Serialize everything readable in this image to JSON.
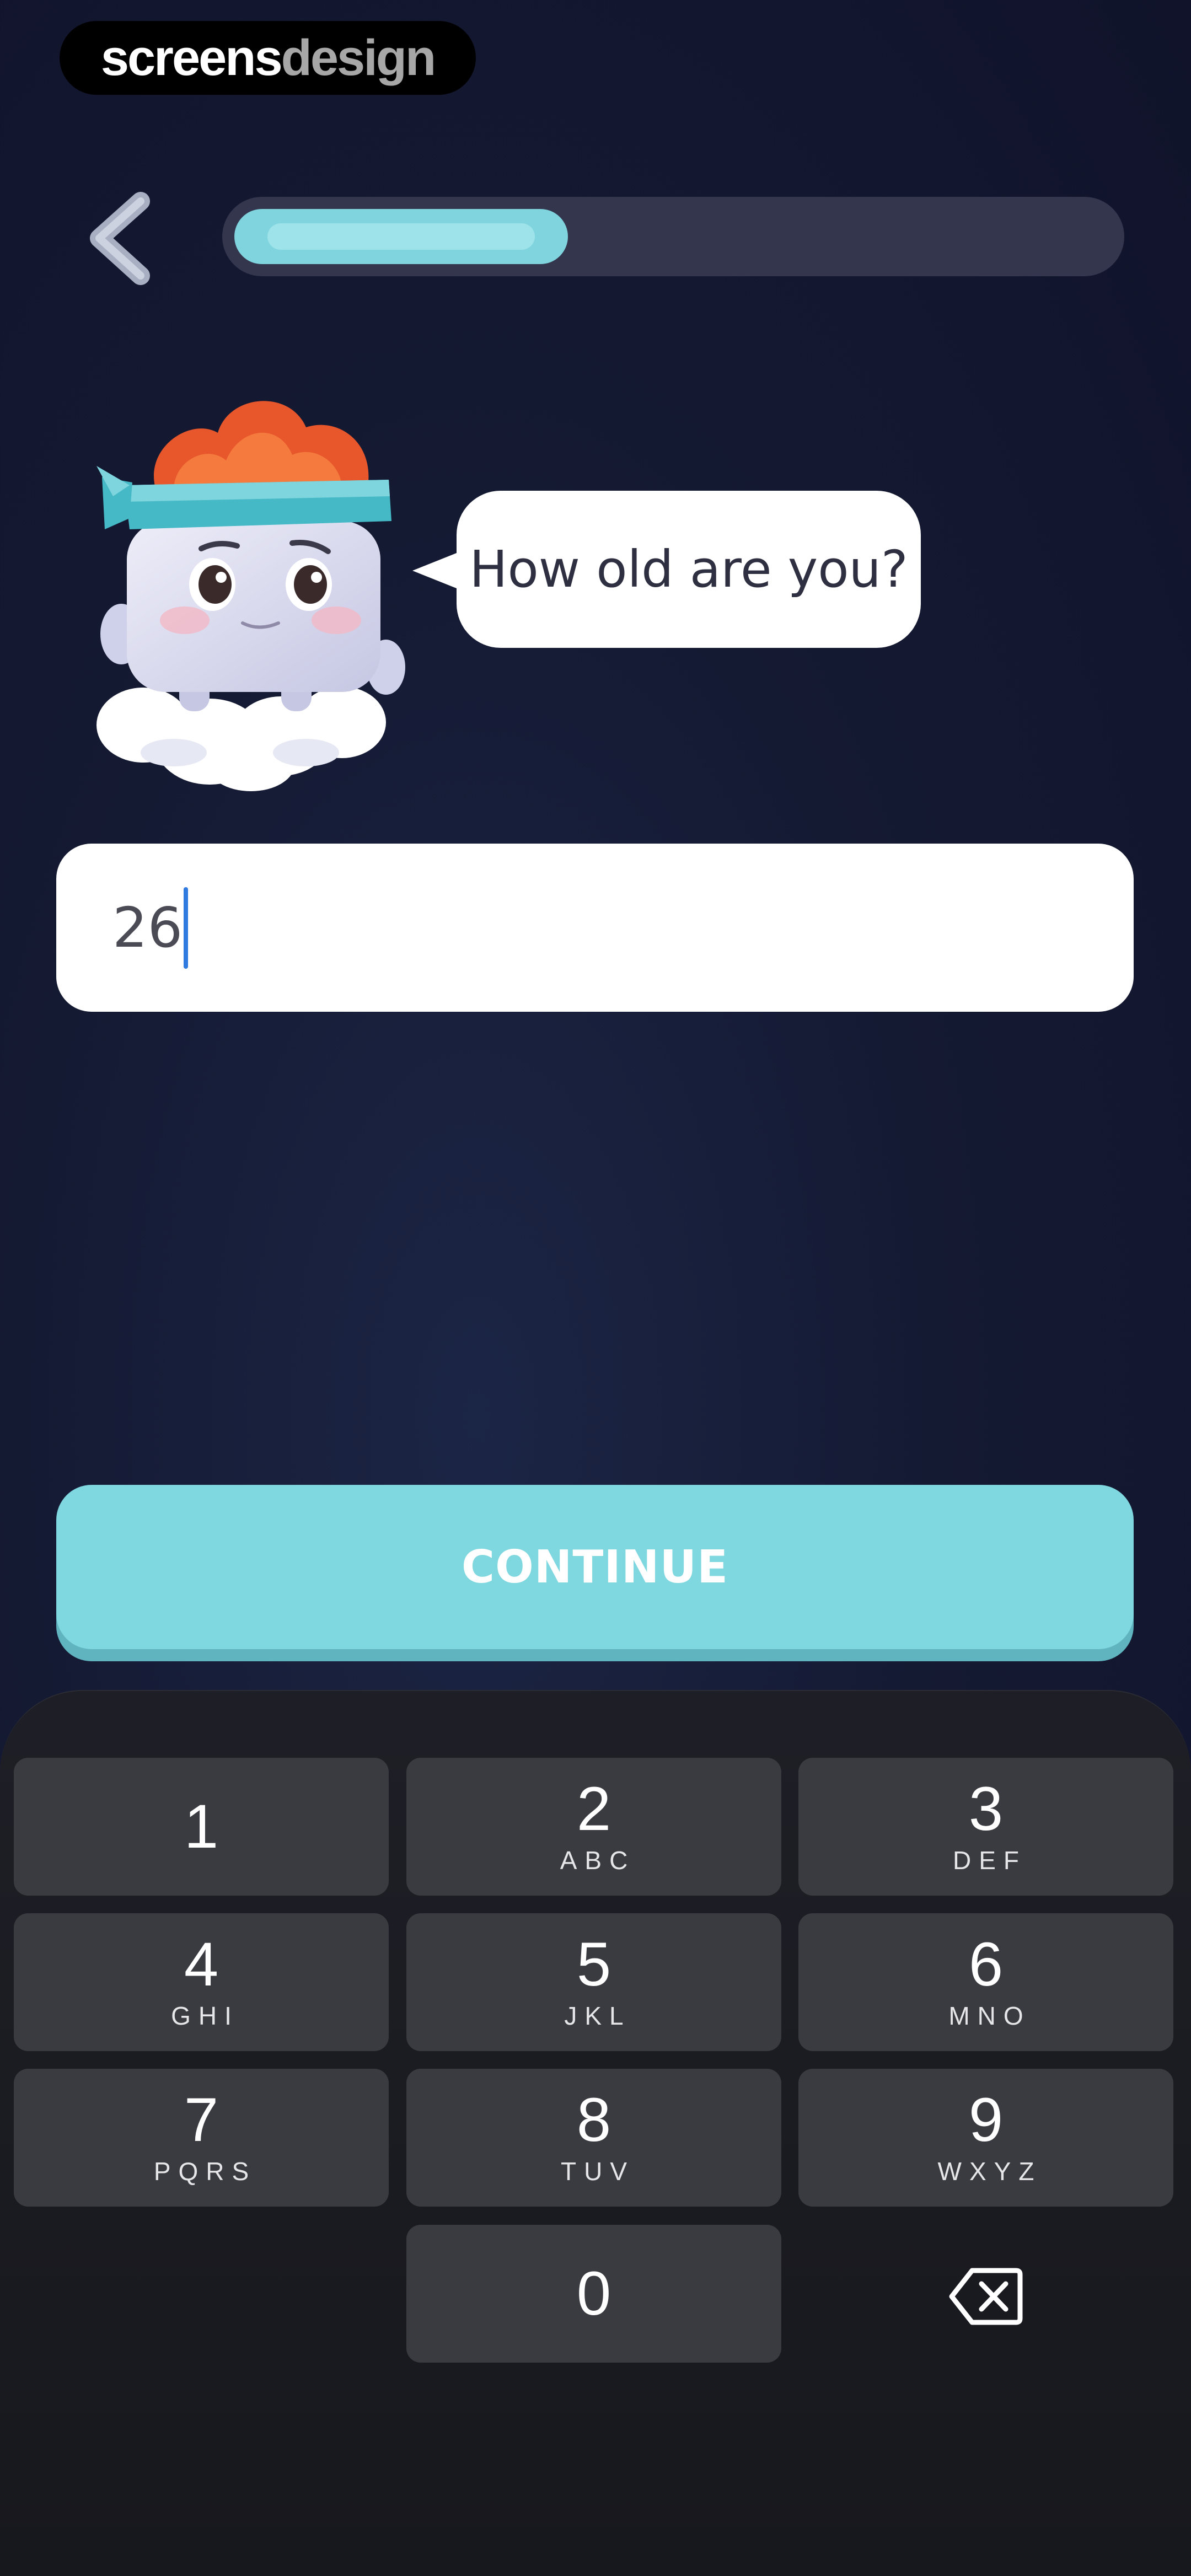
{
  "watermark": {
    "part1": "screens",
    "part2": "design"
  },
  "header": {
    "back_icon": "chevron-left-icon",
    "progress_fraction": 0.38
  },
  "bubble": {
    "question": "How old are you?"
  },
  "age_input": {
    "value": "26"
  },
  "continue_label": "CONTINUE",
  "keypad": {
    "keys": [
      {
        "digit": "1",
        "letters": ""
      },
      {
        "digit": "2",
        "letters": "ABC"
      },
      {
        "digit": "3",
        "letters": "DEF"
      },
      {
        "digit": "4",
        "letters": "GHI"
      },
      {
        "digit": "5",
        "letters": "JKL"
      },
      {
        "digit": "6",
        "letters": "MNO"
      },
      {
        "digit": "7",
        "letters": "PQRS"
      },
      {
        "digit": "8",
        "letters": "TUV"
      },
      {
        "digit": "9",
        "letters": "WXYZ"
      },
      {
        "digit": "0",
        "letters": ""
      }
    ],
    "delete_icon": "backspace-icon"
  },
  "colors": {
    "accent": "#7fd7df",
    "background": "#151a33",
    "key": "#3a3b40"
  }
}
